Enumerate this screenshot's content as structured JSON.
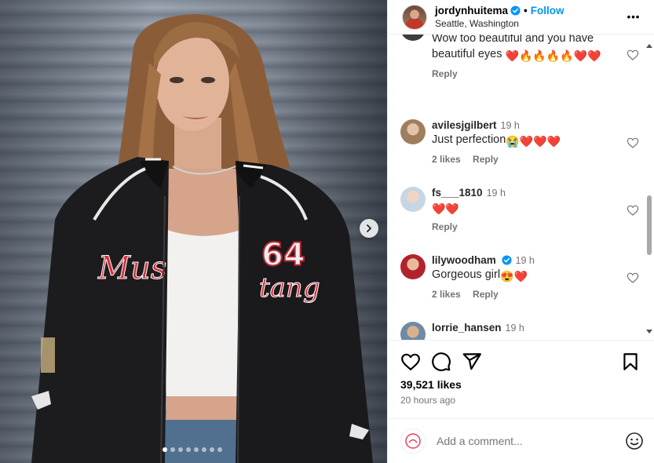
{
  "post": {
    "username": "jordynhuitema",
    "follow_label": "Follow",
    "separator": "•",
    "location": "Seattle, Washington",
    "more_label": "•••"
  },
  "photo": {
    "jacket_text_number": "64",
    "jacket_script": "Mustang",
    "carousel_dots": 8,
    "active_dot": 0
  },
  "comments": [
    {
      "username": "",
      "time": "",
      "text": "Wow too beautiful and you have beautiful eyes",
      "emojis": "❤️🔥🔥🔥🔥❤️❤️",
      "likes": "",
      "reply": "Reply",
      "verified": false
    },
    {
      "username": "avilesjgilbert",
      "time": "19 h",
      "text": "Just perfection",
      "emojis": "😭❤️❤️❤️",
      "likes": "2 likes",
      "reply": "Reply",
      "verified": false
    },
    {
      "username": "fs___1810",
      "time": "19 h",
      "text": "",
      "emojis": "❤️❤️",
      "likes": "",
      "reply": "Reply",
      "verified": false
    },
    {
      "username": "lilywoodham",
      "time": "19 h",
      "text": "Gorgeous girl",
      "emojis": "😍❤️",
      "likes": "2 likes",
      "reply": "Reply",
      "verified": true
    },
    {
      "username": "lorrie_hansen",
      "time": "19 h",
      "text": "",
      "emojis": "",
      "likes": "",
      "reply": "",
      "verified": false
    }
  ],
  "actions": {
    "likes": "39,521 likes",
    "time_ago": "20 hours ago"
  },
  "add_comment": {
    "placeholder": "Add a comment..."
  },
  "colors": {
    "accent": "#0095f6",
    "heart": "#e0141e",
    "muted": "#737373"
  }
}
